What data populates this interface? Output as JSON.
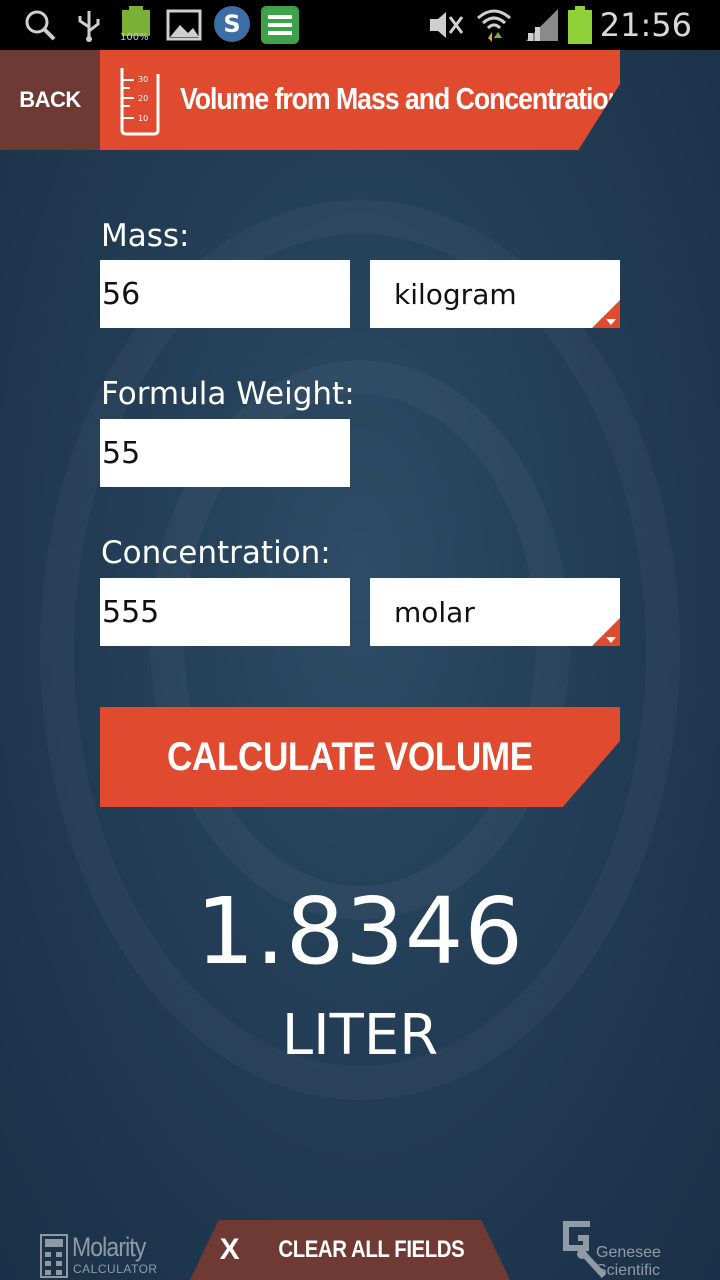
{
  "status_bar": {
    "time": "21:56",
    "battery_label": "100%",
    "icons": [
      "search-icon",
      "usb-icon",
      "battery-full-icon",
      "image-icon",
      "app-s-icon",
      "app-green-icon",
      "mute-icon",
      "wifi-icon",
      "signal-icon",
      "battery-icon"
    ]
  },
  "header": {
    "back_label": "BACK",
    "title": "Volume from Mass and Concentration",
    "icon": "graduated-cylinder-icon",
    "icon_ticks": [
      "30",
      "20",
      "10"
    ]
  },
  "form": {
    "mass": {
      "label": "Mass:",
      "value": "56",
      "unit": "kilogram"
    },
    "formula_weight": {
      "label": "Formula Weight:",
      "value": "55"
    },
    "concentration": {
      "label": "Concentration:",
      "value": "555",
      "unit": "molar"
    }
  },
  "calculate_label": "CALCULATE VOLUME",
  "result": {
    "value": "1.8346",
    "unit": "LITER"
  },
  "footer": {
    "clear_icon": "X",
    "clear_label": "CLEAR ALL FIELDS",
    "left_logo": {
      "title": "Molarity",
      "subtitle": "CALCULATOR"
    },
    "right_logo": {
      "line1": "Genesee",
      "line2": "Scientific"
    }
  },
  "colors": {
    "accent": "#e04a2e",
    "back_button": "#6f3a33",
    "background": "#233e56"
  }
}
